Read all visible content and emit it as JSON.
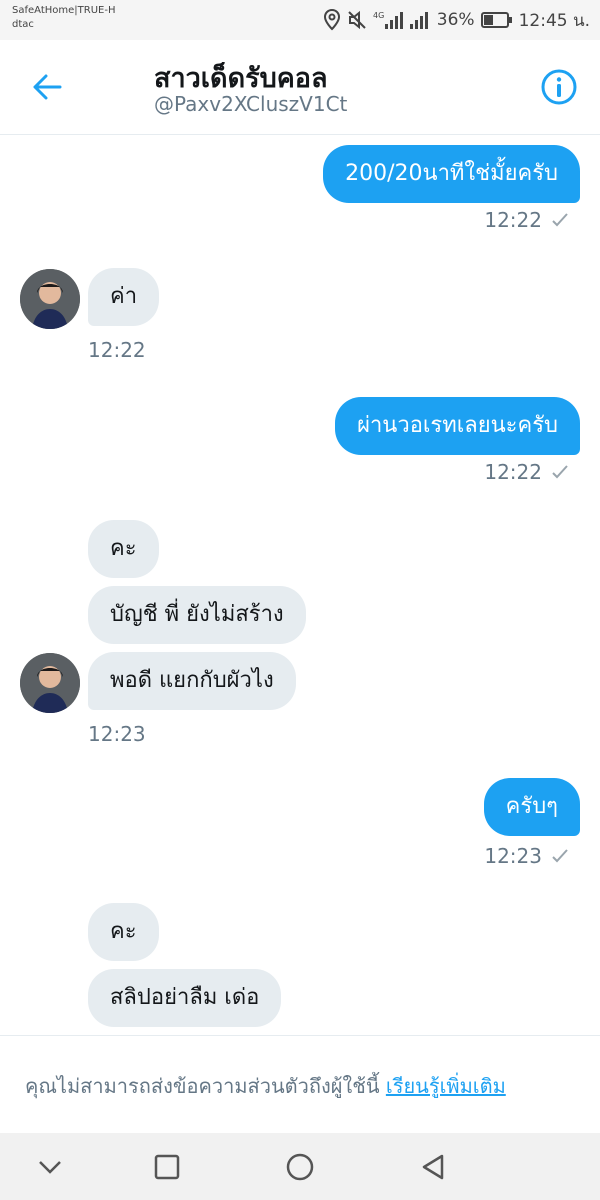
{
  "status_bar": {
    "carrier_line1": "SafeAtHome|TRUE-H",
    "carrier_line2": "dtac",
    "network_label": "4G",
    "battery": "36%",
    "time": "12:45 น."
  },
  "header": {
    "title": "สาวเด็ดรับคอล",
    "handle": "@Paxv2XCluszV1Ct",
    "back_icon": "arrow-left-icon",
    "info_icon": "info-icon"
  },
  "messages": [
    {
      "side": "out",
      "text": "200/20นาทีใช่มั้ยครับ",
      "time": "12:22"
    },
    {
      "side": "in",
      "text": "ค่า",
      "time": "12:22"
    },
    {
      "side": "out",
      "text": "ผ่านวอเรทเลยนะครับ",
      "time": "12:22"
    },
    {
      "side": "in",
      "text": "คะ"
    },
    {
      "side": "in",
      "text": "บัญชี  พี่    ยังไม่สร้าง"
    },
    {
      "side": "in",
      "text": "พอดี แยกกับผัวไง",
      "time": "12:23"
    },
    {
      "side": "out",
      "text": "ครับๆ",
      "time": "12:23"
    },
    {
      "side": "in",
      "text": "คะ"
    },
    {
      "side": "in",
      "text": "สลิปอย่าลืม  เด่อ"
    }
  ],
  "notice": {
    "text": "คุณไม่สามารถส่งข้อความส่วนตัวถึงผู้ใช้นี้ ",
    "link": "เรียนรู้เพิ่มเติม"
  },
  "colors": {
    "accent": "#1da1f2",
    "incoming_bubble": "#e6ecf0",
    "muted_text": "#657786"
  }
}
